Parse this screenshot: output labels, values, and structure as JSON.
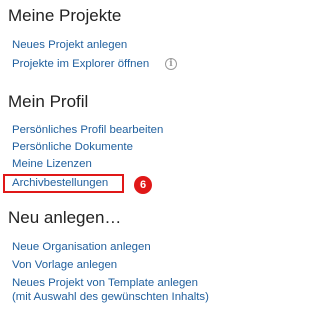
{
  "sections": [
    {
      "heading": "Meine Projekte",
      "links": [
        {
          "label": "Neues Projekt anlegen"
        },
        {
          "label": "Projekte im Explorer öffnen"
        }
      ]
    },
    {
      "heading": "Mein Profil",
      "links": [
        {
          "label": "Persönliches Profil bearbeiten"
        },
        {
          "label": "Persönliche Dokumente"
        },
        {
          "label": "Meine Lizenzen"
        },
        {
          "label": "Archivbestellungen"
        }
      ]
    },
    {
      "heading": "Neu anlegen…",
      "links": [
        {
          "label": "Neue Organisation anlegen"
        },
        {
          "label": "Von Vorlage anlegen"
        },
        {
          "label_line1": "Neues Projekt von Template anlegen",
          "label_line2": "(mit Auswahl des gewünschten Inhalts)"
        }
      ]
    }
  ],
  "icons": {
    "info": "info-icon",
    "info_glyph": "i"
  },
  "annotation": {
    "step_number": "6",
    "color": "#e01818"
  },
  "colors": {
    "link": "#1f5f9e",
    "heading": "#222222",
    "background": "#ffffff"
  }
}
